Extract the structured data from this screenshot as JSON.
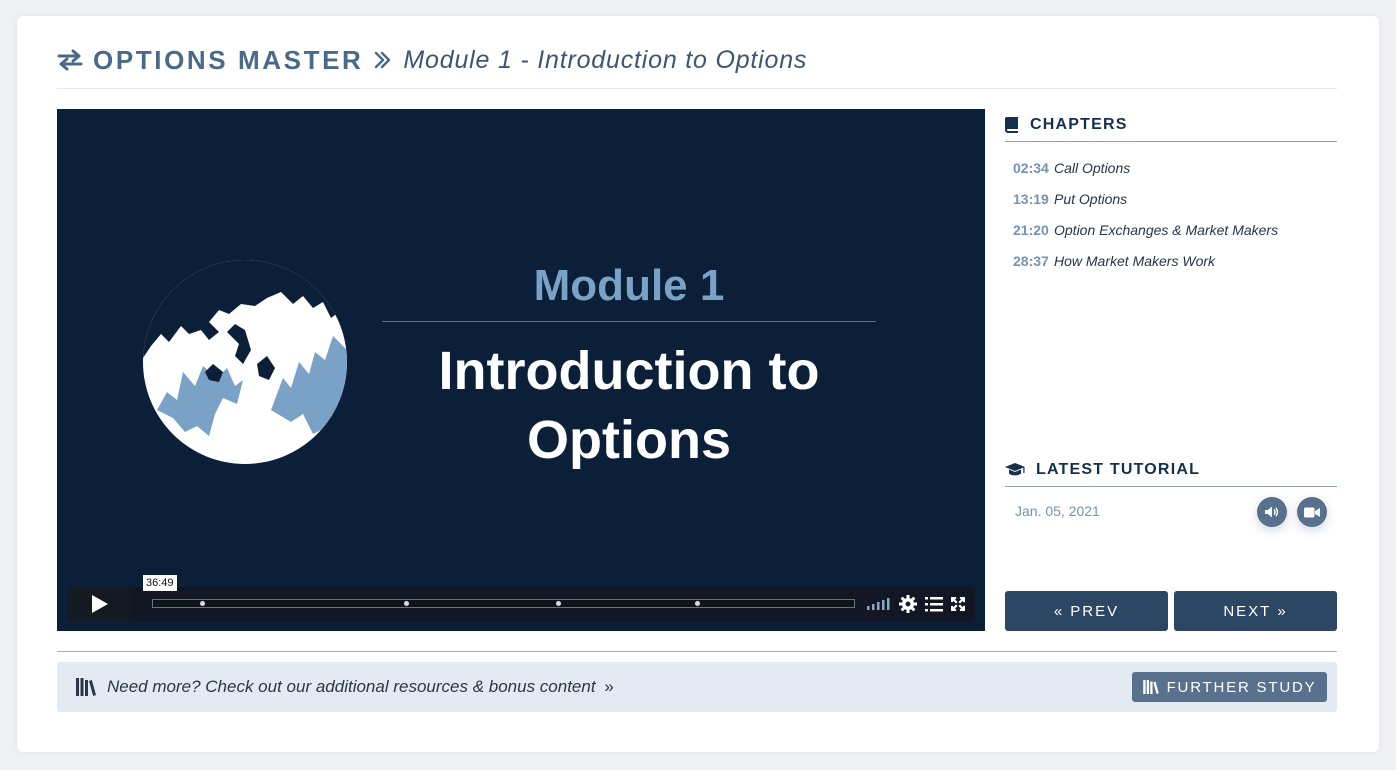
{
  "header": {
    "brand": "OPTIONS MASTER",
    "module_title": "Module 1 - Introduction to Options"
  },
  "video": {
    "slide_module": "Module 1",
    "slide_title_line1": "Introduction to",
    "slide_title_line2": "Options",
    "duration": "36:49",
    "chapter_markers_fraction": [
      0.07,
      0.362,
      0.579,
      0.777
    ]
  },
  "chapters": {
    "heading": "CHAPTERS",
    "items": [
      {
        "time": "02:34",
        "name": "Call Options"
      },
      {
        "time": "13:19",
        "name": "Put Options"
      },
      {
        "time": "21:20",
        "name": "Option Exchanges & Market Makers"
      },
      {
        "time": "28:37",
        "name": "How Market Makers Work"
      }
    ]
  },
  "latest": {
    "heading": "LATEST TUTORIAL",
    "date": "Jan. 05, 2021"
  },
  "nav": {
    "prev_label": "PREV",
    "next_label": "NEXT"
  },
  "footer": {
    "text": "Need more? Check out our additional resources & bonus content",
    "button_label": "FURTHER STUDY"
  },
  "colors": {
    "brand": "#4a6a8a",
    "video_bg": "#0c1f38",
    "nav_button": "#2c4763",
    "accent": "#58718d",
    "chapter_time": "#7593b0",
    "footer_bg": "#e3eaf2"
  },
  "icons": [
    "swap-arrows-icon",
    "double-chevron-right-icon",
    "book-icon",
    "graduation-cap-icon",
    "volume-icon",
    "video-camera-icon",
    "library-books-icon",
    "play-icon",
    "volume-bars-icon",
    "gear-icon",
    "list-icon",
    "fullscreen-icon"
  ]
}
